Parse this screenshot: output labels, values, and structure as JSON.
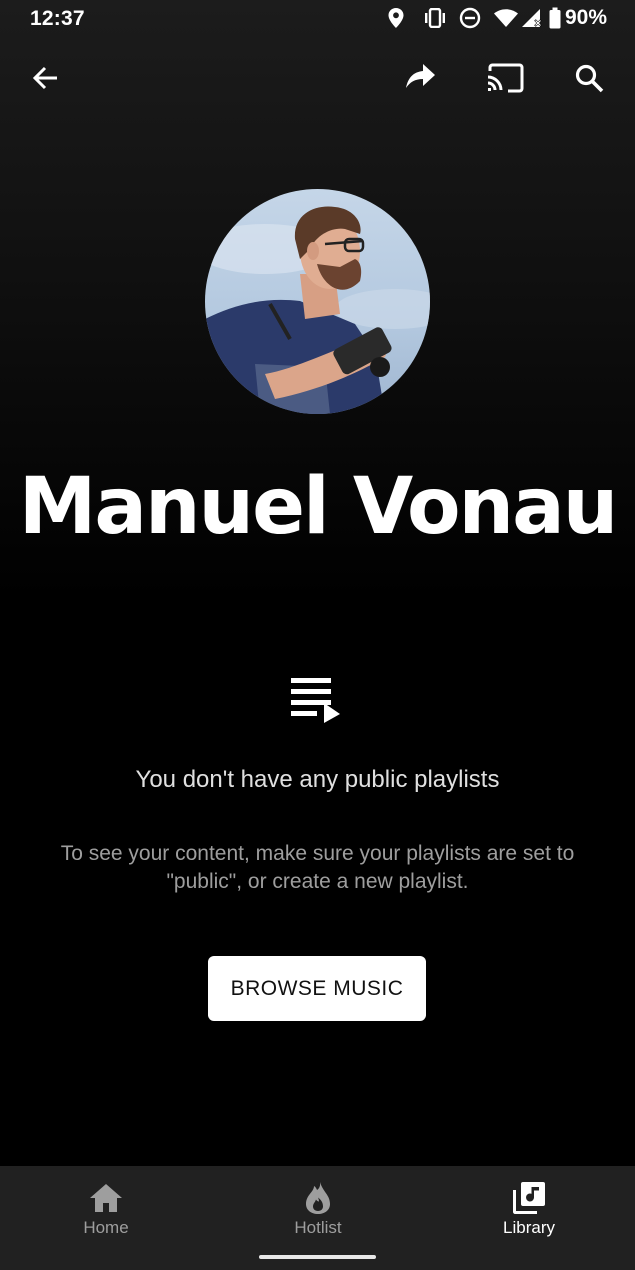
{
  "status_bar": {
    "time": "12:37",
    "battery": "90%",
    "icons": [
      "location-icon",
      "vibrate-icon",
      "do-not-disturb-icon",
      "wifi-icon",
      "cell-signal-icon",
      "battery-icon"
    ]
  },
  "toolbar": {
    "icons": [
      "back-arrow-icon",
      "share-icon",
      "cast-icon",
      "search-icon"
    ]
  },
  "profile": {
    "name": "Manuel Vonau"
  },
  "empty_state": {
    "icon": "playlist-play-icon",
    "title": "You don't have any public playlists",
    "description": "To see your content, make sure your playlists are set to \"public\", or create a new playlist.",
    "button_label": "BROWSE MUSIC"
  },
  "bottom_nav": {
    "items": [
      {
        "label": "Home",
        "icon": "home-icon",
        "active": false
      },
      {
        "label": "Hotlist",
        "icon": "fire-icon",
        "active": false
      },
      {
        "label": "Library",
        "icon": "library-music-icon",
        "active": true
      }
    ]
  },
  "colors": {
    "background": "#000000",
    "nav_background": "#212121",
    "button_background": "#ffffff",
    "inactive_label": "#9e9e9e"
  }
}
